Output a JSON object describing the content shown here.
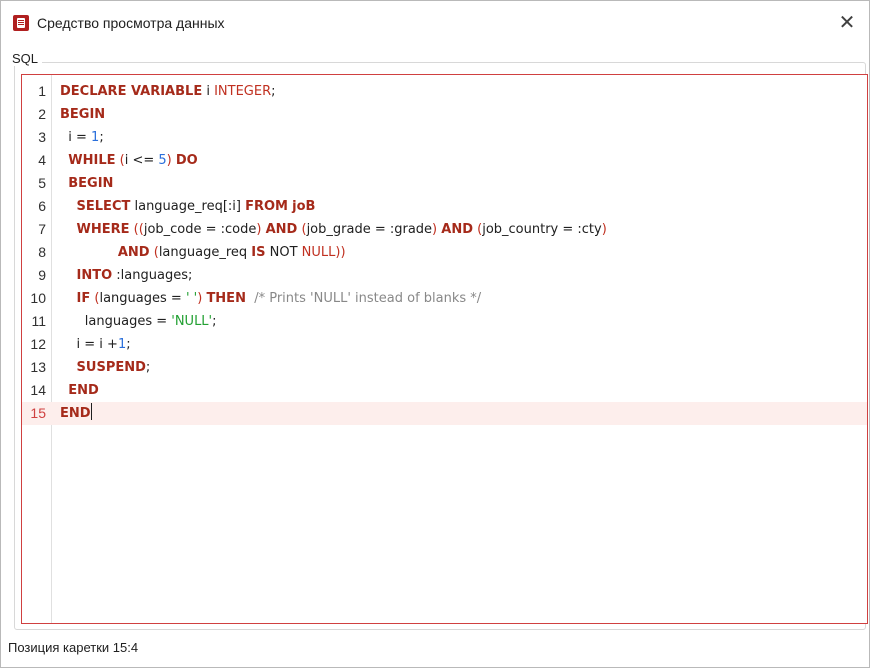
{
  "window": {
    "title": "Средство просмотра данных",
    "close_glyph": "✕"
  },
  "group": {
    "label": "SQL"
  },
  "editor": {
    "current_line": 15,
    "lines": [
      {
        "n": "1",
        "tokens": [
          {
            "c": "kw",
            "t": "DECLARE VARIABLE"
          },
          {
            "c": "",
            "t": " i "
          },
          {
            "c": "op",
            "t": "INTEGER"
          },
          {
            "c": "",
            "t": ";"
          }
        ]
      },
      {
        "n": "2",
        "tokens": [
          {
            "c": "kw",
            "t": "BEGIN"
          }
        ]
      },
      {
        "n": "3",
        "tokens": [
          {
            "c": "",
            "t": "  i = "
          },
          {
            "c": "num",
            "t": "1"
          },
          {
            "c": "",
            "t": ";"
          }
        ]
      },
      {
        "n": "4",
        "tokens": [
          {
            "c": "",
            "t": "  "
          },
          {
            "c": "kw",
            "t": "WHILE"
          },
          {
            "c": "",
            "t": " "
          },
          {
            "c": "op",
            "t": "("
          },
          {
            "c": "",
            "t": "i <= "
          },
          {
            "c": "num",
            "t": "5"
          },
          {
            "c": "op",
            "t": ")"
          },
          {
            "c": "",
            "t": " "
          },
          {
            "c": "kw",
            "t": "DO"
          }
        ]
      },
      {
        "n": "5",
        "tokens": [
          {
            "c": "",
            "t": "  "
          },
          {
            "c": "kw",
            "t": "BEGIN"
          }
        ]
      },
      {
        "n": "6",
        "tokens": [
          {
            "c": "",
            "t": "    "
          },
          {
            "c": "kw",
            "t": "SELECT"
          },
          {
            "c": "",
            "t": " language_req[:i] "
          },
          {
            "c": "kw",
            "t": "FROM"
          },
          {
            "c": "",
            "t": " "
          },
          {
            "c": "kw",
            "t": "joB"
          }
        ]
      },
      {
        "n": "7",
        "tokens": [
          {
            "c": "",
            "t": "    "
          },
          {
            "c": "kw",
            "t": "WHERE"
          },
          {
            "c": "",
            "t": " "
          },
          {
            "c": "op",
            "t": "(("
          },
          {
            "c": "",
            "t": "job_code = :code"
          },
          {
            "c": "op",
            "t": ")"
          },
          {
            "c": "",
            "t": " "
          },
          {
            "c": "kw",
            "t": "AND"
          },
          {
            "c": "",
            "t": " "
          },
          {
            "c": "op",
            "t": "("
          },
          {
            "c": "",
            "t": "job_grade = :grade"
          },
          {
            "c": "op",
            "t": ")"
          },
          {
            "c": "",
            "t": " "
          },
          {
            "c": "kw",
            "t": "AND"
          },
          {
            "c": "",
            "t": " "
          },
          {
            "c": "op",
            "t": "("
          },
          {
            "c": "",
            "t": "job_country = :cty"
          },
          {
            "c": "op",
            "t": ")"
          }
        ]
      },
      {
        "n": "8",
        "tokens": [
          {
            "c": "",
            "t": "              "
          },
          {
            "c": "kw",
            "t": "AND"
          },
          {
            "c": "",
            "t": " "
          },
          {
            "c": "op",
            "t": "("
          },
          {
            "c": "",
            "t": "language_req "
          },
          {
            "c": "kw",
            "t": "IS"
          },
          {
            "c": "",
            "t": " NOT "
          },
          {
            "c": "op",
            "t": "NULL))"
          }
        ]
      },
      {
        "n": "9",
        "tokens": [
          {
            "c": "",
            "t": "    "
          },
          {
            "c": "kw",
            "t": "INTO"
          },
          {
            "c": "",
            "t": " :languages;"
          }
        ]
      },
      {
        "n": "10",
        "tokens": [
          {
            "c": "",
            "t": "    "
          },
          {
            "c": "kw",
            "t": "IF"
          },
          {
            "c": "",
            "t": " "
          },
          {
            "c": "op",
            "t": "("
          },
          {
            "c": "",
            "t": "languages = "
          },
          {
            "c": "str",
            "t": "' '"
          },
          {
            "c": "op",
            "t": ")"
          },
          {
            "c": "",
            "t": " "
          },
          {
            "c": "kw",
            "t": "THEN"
          },
          {
            "c": "",
            "t": "  "
          },
          {
            "c": "cmt",
            "t": "/* Prints 'NULL' instead of blanks */"
          }
        ]
      },
      {
        "n": "11",
        "tokens": [
          {
            "c": "",
            "t": "      languages = "
          },
          {
            "c": "str",
            "t": "'NULL'"
          },
          {
            "c": "",
            "t": ";"
          }
        ]
      },
      {
        "n": "12",
        "tokens": [
          {
            "c": "",
            "t": "    i = i +"
          },
          {
            "c": "num",
            "t": "1"
          },
          {
            "c": "",
            "t": ";"
          }
        ]
      },
      {
        "n": "13",
        "tokens": [
          {
            "c": "",
            "t": "    "
          },
          {
            "c": "kw",
            "t": "SUSPEND"
          },
          {
            "c": "",
            "t": ";"
          }
        ]
      },
      {
        "n": "14",
        "tokens": [
          {
            "c": "",
            "t": "  "
          },
          {
            "c": "kw",
            "t": "END"
          }
        ]
      },
      {
        "n": "15",
        "tokens": [
          {
            "c": "kw",
            "t": "END"
          }
        ]
      }
    ]
  },
  "status": {
    "caret_position": "Позиция каретки 15:4"
  },
  "icons": {
    "app": "database-viewer-icon",
    "close": "close-icon"
  }
}
